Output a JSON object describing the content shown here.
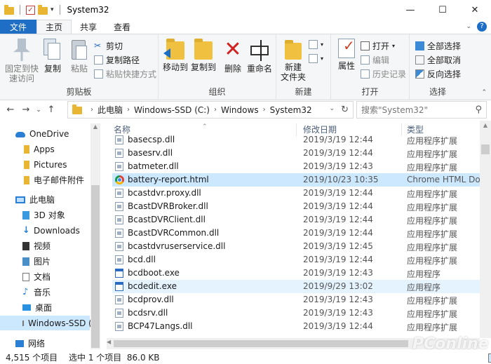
{
  "window": {
    "title": "System32",
    "controls": {
      "minimize": "—",
      "maximize": "☐",
      "close": "✕"
    }
  },
  "quick_access": {
    "dropdown": "▾"
  },
  "ribbon_tabs": [
    {
      "label": "文件"
    },
    {
      "label": "主页"
    },
    {
      "label": "共享"
    },
    {
      "label": "查看"
    }
  ],
  "ribbon": {
    "clipboard": {
      "pin_label": "固定到快\n速访问",
      "copy_label": "复制",
      "paste_label": "粘贴",
      "cut_label": "剪切",
      "copy_path_label": "复制路径",
      "paste_shortcut_label": "粘贴快捷方式",
      "group_label": "剪贴板"
    },
    "organize": {
      "move_to_label": "移动到",
      "copy_to_label": "复制到",
      "delete_label": "删除",
      "rename_label": "重命名",
      "group_label": "组织"
    },
    "new": {
      "new_folder_label": "新建\n文件夹",
      "group_label": "新建"
    },
    "open": {
      "properties_label": "属性",
      "open_label": "打开",
      "edit_label": "编辑",
      "history_label": "历史记录",
      "group_label": "打开"
    },
    "select": {
      "select_all_label": "全部选择",
      "select_none_label": "全部取消",
      "invert_label": "反向选择",
      "group_label": "选择"
    }
  },
  "address": {
    "crumbs": [
      "此电脑",
      "Windows-SSD (C:)",
      "Windows",
      "System32"
    ]
  },
  "search": {
    "placeholder": "搜索\"System32\""
  },
  "nav_pane": [
    {
      "label": "OneDrive",
      "icon": "onedrive-icon"
    },
    {
      "label": "Apps",
      "icon": "folder-icon"
    },
    {
      "label": "Pictures",
      "icon": "folder-icon"
    },
    {
      "label": "电子邮件附件",
      "icon": "folder-icon"
    },
    {
      "label": "此电脑",
      "icon": "this-pc-icon"
    },
    {
      "label": "3D 对象",
      "icon": "3d-objects-icon"
    },
    {
      "label": "Downloads",
      "icon": "downloads-icon"
    },
    {
      "label": "视频",
      "icon": "videos-icon"
    },
    {
      "label": "图片",
      "icon": "pictures-icon"
    },
    {
      "label": "文档",
      "icon": "documents-icon"
    },
    {
      "label": "音乐",
      "icon": "music-icon"
    },
    {
      "label": "桌面",
      "icon": "desktop-icon"
    },
    {
      "label": "Windows-SSD (",
      "icon": "drive-icon"
    },
    {
      "label": "网络",
      "icon": "network-icon"
    }
  ],
  "columns": {
    "name": "名称",
    "date": "修改日期",
    "type": "类型"
  },
  "files": [
    {
      "name": "basecsp.dll",
      "date": "2019/3/19 12:44",
      "type": "应用程序扩展",
      "icon": "dll"
    },
    {
      "name": "basesrv.dll",
      "date": "2019/3/19 12:44",
      "type": "应用程序扩展",
      "icon": "dll"
    },
    {
      "name": "batmeter.dll",
      "date": "2019/3/19 12:43",
      "type": "应用程序扩展",
      "icon": "dll"
    },
    {
      "name": "battery-report.html",
      "date": "2019/10/23 10:35",
      "type": "Chrome HTML Doc...",
      "icon": "chrome",
      "state": "selected"
    },
    {
      "name": "bcastdvr.proxy.dll",
      "date": "2019/3/19 12:44",
      "type": "应用程序扩展",
      "icon": "dll"
    },
    {
      "name": "BcastDVRBroker.dll",
      "date": "2019/3/19 12:44",
      "type": "应用程序扩展",
      "icon": "dll"
    },
    {
      "name": "BcastDVRClient.dll",
      "date": "2019/3/19 12:44",
      "type": "应用程序扩展",
      "icon": "dll"
    },
    {
      "name": "BcastDVRCommon.dll",
      "date": "2019/3/19 12:44",
      "type": "应用程序扩展",
      "icon": "dll"
    },
    {
      "name": "bcastdvruserservice.dll",
      "date": "2019/3/19 12:45",
      "type": "应用程序扩展",
      "icon": "dll"
    },
    {
      "name": "bcd.dll",
      "date": "2019/3/19 12:44",
      "type": "应用程序扩展",
      "icon": "dll"
    },
    {
      "name": "bcdboot.exe",
      "date": "2019/3/19 12:43",
      "type": "应用程序",
      "icon": "exe"
    },
    {
      "name": "bcdedit.exe",
      "date": "2019/9/29 13:02",
      "type": "应用程序",
      "icon": "exe",
      "state": "hover"
    },
    {
      "name": "bcdprov.dll",
      "date": "2019/3/19 12:43",
      "type": "应用程序扩展",
      "icon": "dll"
    },
    {
      "name": "bcdsrv.dll",
      "date": "2019/3/19 12:43",
      "type": "应用程序扩展",
      "icon": "dll"
    },
    {
      "name": "BCP47Langs.dll",
      "date": "2019/3/19 12:44",
      "type": "应用程序扩展",
      "icon": "dll"
    }
  ],
  "status": {
    "item_count": "4,515 个项目",
    "selection": "选中 1 个项目  86.0 KB"
  },
  "watermark": "PConline",
  "colors": {
    "accent": "#1e6ec5",
    "selection": "#cce8ff",
    "hover": "#e5f3ff"
  }
}
